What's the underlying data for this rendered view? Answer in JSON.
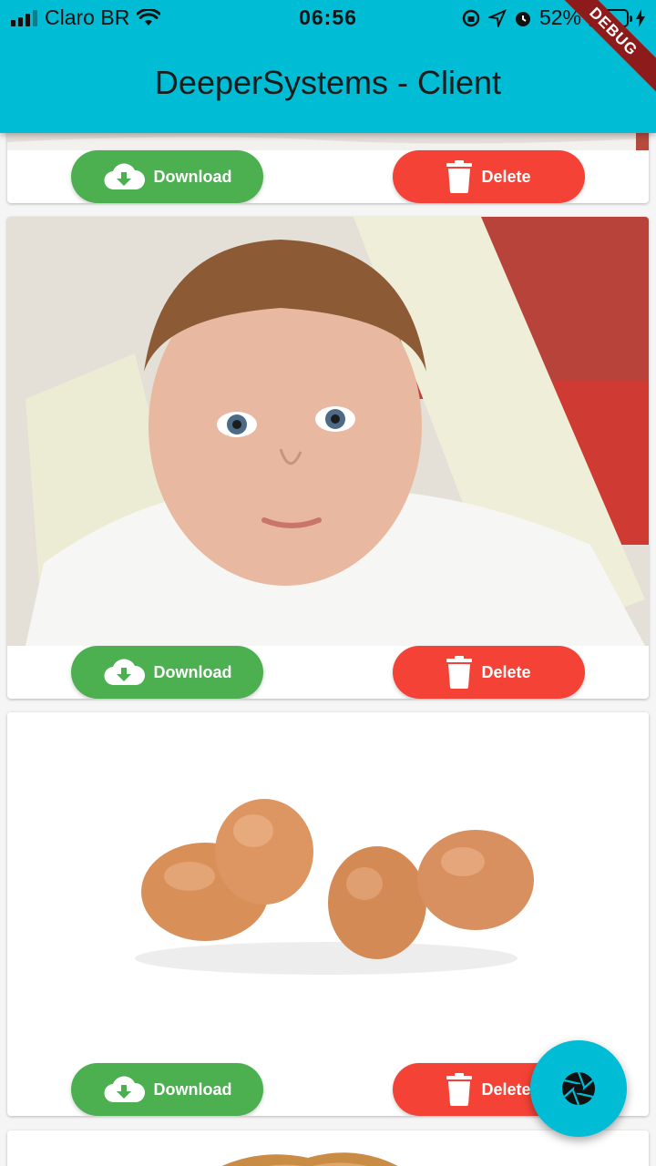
{
  "status_bar": {
    "carrier": "Claro BR",
    "time": "06:56",
    "battery": "52%",
    "battery_level": 0.52
  },
  "app_bar": {
    "title": "DeeperSystems - Client"
  },
  "debug_banner": "DEBUG",
  "cards": [
    {
      "image": "baby-photo-partial",
      "download_label": "Download",
      "delete_label": "Delete"
    },
    {
      "image": "baby-photo",
      "download_label": "Download",
      "delete_label": "Delete"
    },
    {
      "image": "eggs-photo",
      "download_label": "Download",
      "delete_label": "Delete"
    },
    {
      "image": "bread-photo-partial"
    }
  ],
  "icons": {
    "download": "cloud-download-icon",
    "delete": "trash-icon",
    "fab": "camera-shutter-icon"
  },
  "colors": {
    "primary": "#00bcd4",
    "download": "#4caf50",
    "delete": "#f44336"
  }
}
